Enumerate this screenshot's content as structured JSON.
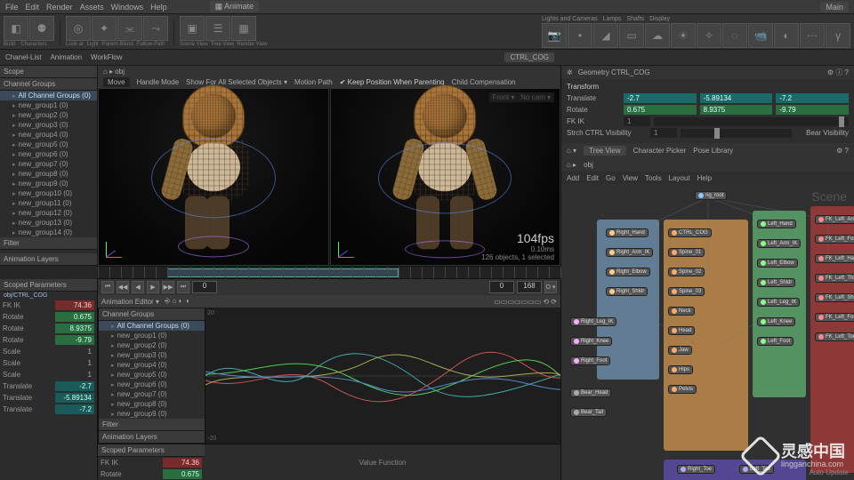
{
  "app": {
    "title": "Animate",
    "secondary": "Main"
  },
  "menubar": [
    "File",
    "Edit",
    "Render",
    "Assets",
    "Windows",
    "Help"
  ],
  "shelf_groups": [
    [
      "Build",
      "Characters"
    ],
    [
      "Look at",
      "Light",
      "Parent-Blend",
      "Follow-Path"
    ],
    [
      "Scene View",
      "Tree View",
      "Render View"
    ],
    [
      "Lights and Cameras",
      "Lamps",
      "Shafts",
      "Display"
    ],
    [
      "Camera",
      "Point-Light",
      "Spot-Light",
      "Area-Light",
      "Atmosphere",
      "Directional-Light",
      "Cloud-Light",
      "Ambient-Light",
      "Camera",
      "VR-Cam",
      "Misc",
      "Gamma"
    ]
  ],
  "sub_shelf": {
    "left": [
      "Chanel-List",
      "Animation",
      "WorkFlow"
    ],
    "right": [
      "CTRL_COG"
    ]
  },
  "scope_panel": {
    "title": "Scope",
    "cg_header": "Channel Groups",
    "root": "All Channel Groups (0)",
    "items": [
      "new_group1 (0)",
      "new_group2 (0)",
      "new_group3 (0)",
      "new_group4 (0)",
      "new_group5 (0)",
      "new_group6 (0)",
      "new_group7 (0)",
      "new_group8 (0)",
      "new_group9 (0)",
      "new_group10 (0)",
      "new_group11 (0)",
      "new_group12 (0)",
      "new_group13 (0)",
      "new_group14 (0)"
    ],
    "filter": "Filter",
    "anim_layers": "Animation Layers"
  },
  "viewport_opts": {
    "mode": "Move",
    "handle": "Handle Mode",
    "showall": "Show For All Selected Objects ▾",
    "motion": "Motion Path",
    "keep": "✔ Keep Position When Parenting",
    "child": "Child Compensation",
    "cam_front": "Front ▾",
    "cam_none": "No cam ▾",
    "fps": "104fps",
    "fps_sub": "0.10ms",
    "status": "126 objects, 1 selected"
  },
  "playbar": {
    "start": "0",
    "end": "168",
    "cur": "0",
    "opts": "O ▾"
  },
  "scoped_params": {
    "title": "Scoped Parameters",
    "obj": "obj/CTRL_COG",
    "rows": [
      {
        "lbl": "FK IK",
        "val": "74.36",
        "cls": "val-red"
      },
      {
        "lbl": "Rotate",
        "val": "0.675",
        "cls": "val-green"
      },
      {
        "lbl": "Rotate",
        "val": "8.9375",
        "cls": "val-green"
      },
      {
        "lbl": "Rotate",
        "val": "-9.79",
        "cls": "val-green"
      },
      {
        "lbl": "Scale",
        "val": "1",
        "cls": ""
      },
      {
        "lbl": "Scale",
        "val": "1",
        "cls": ""
      },
      {
        "lbl": "Scale",
        "val": "1",
        "cls": ""
      },
      {
        "lbl": "Translate",
        "val": "-2.7",
        "cls": "val-teal"
      },
      {
        "lbl": "Translate",
        "val": "-5.89134",
        "cls": "val-teal"
      },
      {
        "lbl": "Translate",
        "val": "-7.2",
        "cls": "val-teal"
      }
    ]
  },
  "scoped_params2": {
    "title": "Scoped Parameters",
    "rows": [
      {
        "lbl": "FK IK",
        "val": "74.36",
        "cls": "val-red"
      },
      {
        "lbl": "Rotate",
        "val": "0.675",
        "cls": "val-green"
      }
    ],
    "footer": "Value    Function"
  },
  "anim_editor": {
    "title": "Animation Editor ▾",
    "cg_header": "Channel Groups",
    "root": "All Channel Groups (0)",
    "items": [
      "new_group1 (0)",
      "new_group2 (0)",
      "new_group3 (0)",
      "new_group4 (0)",
      "new_group5 (0)",
      "new_group6 (0)",
      "new_group7 (0)",
      "new_group8 (0)",
      "new_group9 (0)"
    ],
    "filter": "Filter",
    "anim_layers": "Animation Layers",
    "ymax": "20",
    "ymin": "-20"
  },
  "geometry": {
    "header": "Geometry  CTRL_COG",
    "section": "Transform",
    "translate": [
      "-2.7",
      "-5.89134",
      "-7.2"
    ],
    "rotate": [
      "0.675",
      "8.9375",
      "-9.79"
    ],
    "fkik": "1",
    "stretch": "Strch CTRL Visibility",
    "bear": "Bear Visibility"
  },
  "node_editor": {
    "tabs": [
      "Tree View",
      "Character Picker",
      "Pose Library"
    ],
    "crumb": "obj",
    "menu": [
      "Add",
      "Edit",
      "Go",
      "View",
      "Tools",
      "Layout",
      "Help"
    ],
    "scene": "Scene",
    "auto": "Auto Update"
  },
  "watermark": {
    "cn": "灵感中国",
    "en": "lingganchina.com"
  }
}
